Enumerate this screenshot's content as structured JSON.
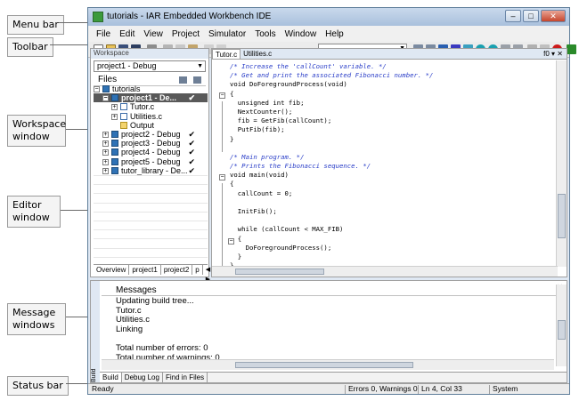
{
  "callouts": {
    "menu_bar": "Menu bar",
    "toolbar": "Toolbar",
    "workspace": [
      "Workspace",
      "window"
    ],
    "editor": [
      "Editor",
      "window"
    ],
    "messages": [
      "Message",
      "windows"
    ],
    "status_bar": "Status bar"
  },
  "window": {
    "title": "tutorials - IAR Embedded Workbench IDE",
    "buttons": [
      "–",
      "□",
      "✕"
    ]
  },
  "menubar": [
    "File",
    "Edit",
    "View",
    "Project",
    "Simulator",
    "Tools",
    "Window",
    "Help"
  ],
  "toolbar": {
    "combo_value": ""
  },
  "workspace": {
    "panel_title": "Workspace",
    "config": "project1 - Debug",
    "files_header": "Files",
    "tree": [
      {
        "label": "tutorials",
        "depth": 0,
        "icon": "workspace-icon",
        "expander": "−",
        "checked": false,
        "selected": false
      },
      {
        "label": "project1 - De...",
        "depth": 1,
        "icon": "project-icon",
        "expander": "−",
        "checked": true,
        "selected": true
      },
      {
        "label": "Tutor.c",
        "depth": 2,
        "icon": "file-icon",
        "expander": "+",
        "checked": false,
        "selected": false
      },
      {
        "label": "Utilities.c",
        "depth": 2,
        "icon": "file-icon",
        "expander": "+",
        "checked": false,
        "selected": false
      },
      {
        "label": "Output",
        "depth": 2,
        "icon": "folder-icon",
        "expander": "",
        "checked": false,
        "selected": false
      },
      {
        "label": "project2 - Debug",
        "depth": 1,
        "icon": "project-icon",
        "expander": "+",
        "checked": true,
        "selected": false
      },
      {
        "label": "project3 - Debug",
        "depth": 1,
        "icon": "project-icon",
        "expander": "+",
        "checked": true,
        "selected": false
      },
      {
        "label": "project4 - Debug",
        "depth": 1,
        "icon": "project-icon",
        "expander": "+",
        "checked": true,
        "selected": false
      },
      {
        "label": "project5 - Debug",
        "depth": 1,
        "icon": "project-icon",
        "expander": "+",
        "checked": true,
        "selected": false
      },
      {
        "label": "tutor_library - De...",
        "depth": 1,
        "icon": "project-icon",
        "expander": "+",
        "checked": true,
        "selected": false
      }
    ],
    "tabs": [
      "Overview",
      "project1",
      "project2",
      "p"
    ],
    "check_mark": "✔"
  },
  "editor": {
    "tabs": [
      "Tutor.c",
      "Utilities.c"
    ],
    "tab_controls": "f0 ▾ ✕",
    "lines": [
      {
        "text": "/* Increase the 'callCount' variable. */",
        "kind": "comment"
      },
      {
        "text": "/* Get and print the associated Fibonacci number. */",
        "kind": "comment"
      },
      {
        "text": "void DoForegroundProcess(void)",
        "kind": "code"
      },
      {
        "text": "{",
        "kind": "code"
      },
      {
        "text": "  unsigned int fib;",
        "kind": "code"
      },
      {
        "text": "  NextCounter();",
        "kind": "code"
      },
      {
        "text": "  fib = GetFib(callCount);",
        "kind": "code"
      },
      {
        "text": "  PutFib(fib);",
        "kind": "code"
      },
      {
        "text": "}",
        "kind": "code"
      },
      {
        "text": "",
        "kind": "code"
      },
      {
        "text": "/* Main program. */",
        "kind": "comment"
      },
      {
        "text": "/* Prints the Fibonacci sequence. */",
        "kind": "comment"
      },
      {
        "text": "void main(void)",
        "kind": "code"
      },
      {
        "text": "{",
        "kind": "code"
      },
      {
        "text": "  callCount = 0;",
        "kind": "code"
      },
      {
        "text": "",
        "kind": "code"
      },
      {
        "text": "  InitFib();",
        "kind": "code"
      },
      {
        "text": "",
        "kind": "code"
      },
      {
        "text": "  while (callCount < MAX_FIB)",
        "kind": "code"
      },
      {
        "text": "  {",
        "kind": "code"
      },
      {
        "text": "    DoForegroundProcess();",
        "kind": "code"
      },
      {
        "text": "  }",
        "kind": "code"
      },
      {
        "text": "}",
        "kind": "code"
      }
    ]
  },
  "messages": {
    "side_label": "Build",
    "header": "Messages",
    "lines": [
      "Updating build tree...",
      "Tutor.c",
      "Utilities.c",
      "Linking",
      "",
      "Total number of errors: 0",
      "Total number of warnings: 0"
    ],
    "tabs": [
      "Build",
      "Debug Log",
      "Find in Files"
    ],
    "close": "✕"
  },
  "statusbar": {
    "left": "Ready",
    "errors": "Errors 0, Warnings 0",
    "position": "Ln 4, Col 33",
    "mode": "System"
  }
}
